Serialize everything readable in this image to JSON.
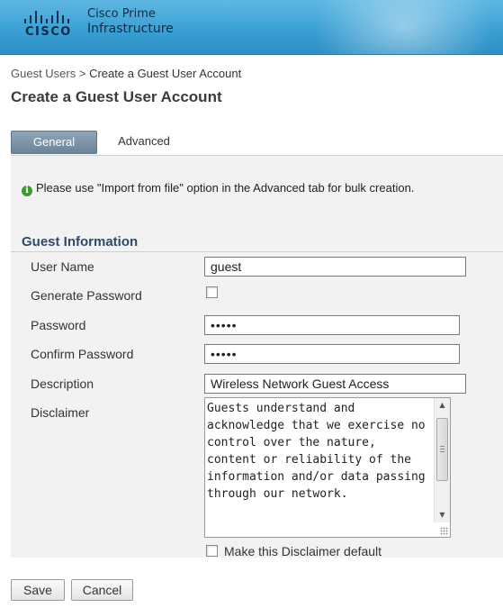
{
  "header": {
    "brand": "CISCO",
    "product_line1": "Cisco Prime",
    "product_line2": "Infrastructure"
  },
  "breadcrumb": {
    "parent": "Guest Users",
    "separator": ">",
    "current": "Create a Guest User Account"
  },
  "page_title": "Create a Guest User Account",
  "tabs": [
    {
      "label": "General",
      "selected": true
    },
    {
      "label": "Advanced",
      "selected": false
    }
  ],
  "info_message": "Please use \"Import from file\" option in the Advanced tab for bulk creation.",
  "section_title": "Guest Information",
  "form": {
    "user_name_label": "User Name",
    "user_name_value": "guest",
    "generate_password_label": "Generate Password",
    "generate_password_checked": false,
    "password_label": "Password",
    "password_value": "•••••",
    "confirm_password_label": "Confirm Password",
    "confirm_password_value": "•••••",
    "description_label": "Description",
    "description_value": "Wireless Network Guest Access",
    "disclaimer_label": "Disclaimer",
    "disclaimer_value": "Guests understand and acknowledge that we exercise no control over the nature, content or reliability of the information and/or data passing through our network.",
    "make_default_label": "Make this Disclaimer default",
    "make_default_checked": false
  },
  "buttons": {
    "save": "Save",
    "cancel": "Cancel"
  },
  "colors": {
    "header_blue": "#3aa0d4",
    "tab_selected": "#7a90a3",
    "section_title": "#2f4a68",
    "info_icon": "#3c9a2e"
  },
  "icons": {
    "info": "info-circle-icon",
    "logo": "cisco-bars-logo"
  }
}
